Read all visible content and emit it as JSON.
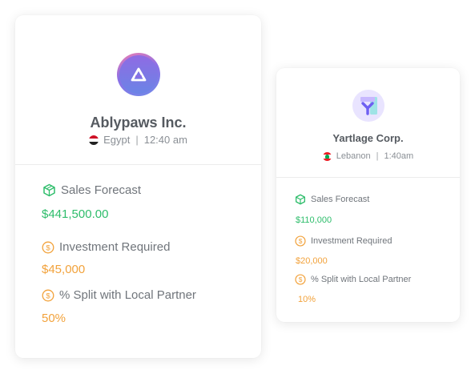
{
  "cards": [
    {
      "company": "Ablypaws Inc.",
      "country": "Egypt",
      "separator": "|",
      "time": "12:40 am",
      "metrics": [
        {
          "label": "Sales Forecast",
          "value": "$441,500.00"
        },
        {
          "label": "Investment Required",
          "value": "$45,000"
        },
        {
          "label": "% Split with Local Partner",
          "value": "50%"
        }
      ]
    },
    {
      "company": "Yartlage Corp.",
      "country": "Lebanon",
      "separator": "|",
      "time": "1:40am",
      "metrics": [
        {
          "label": "Sales Forecast",
          "value": "$110,000"
        },
        {
          "label": "Investment Required",
          "value": "$20,000"
        },
        {
          "label": "% Split with Local Partner",
          "value": "10%"
        }
      ]
    }
  ],
  "colors": {
    "sales_green": "#2ebd6b",
    "money_orange": "#f2a23b",
    "logo_purple": "#7f79e6"
  },
  "icons": {
    "sales": "cube-icon",
    "investment": "dollar-coin-icon",
    "split": "dollar-coin-icon"
  }
}
